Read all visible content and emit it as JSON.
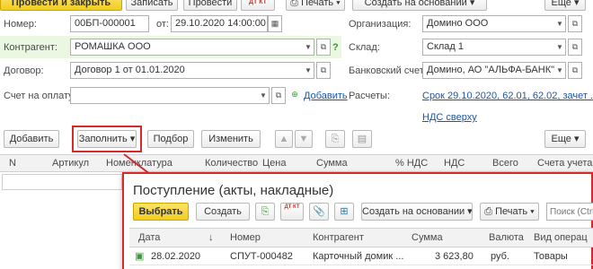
{
  "toolbar": {
    "post_close": "Провести и закрыть",
    "save": "Записать",
    "post": "Провести",
    "dt_kt": "ДТ КТ",
    "print": "Печать",
    "create_based": "Создать на основании",
    "more": "Еще"
  },
  "form": {
    "number_label": "Номер:",
    "number_value": "00БП-000001",
    "date_from_label": "от:",
    "date_value": "29.10.2020 14:00:00",
    "org_label": "Организация:",
    "org_value": "Домино ООО",
    "counterparty_label": "Контрагент:",
    "counterparty_value": "РОМАШКА ООО",
    "help": "?",
    "warehouse_label": "Склад:",
    "warehouse_value": "Склад 1",
    "contract_label": "Договор:",
    "contract_value": "Договор 1 от 01.01.2020",
    "bank_label": "Банковский счет:",
    "bank_value": "Домино, АО \"АЛЬФА-БАНК\"",
    "invoice_label": "Счет на оплату:",
    "invoice_value": "",
    "add_link": "Добавить",
    "settlements_label": "Расчеты:",
    "settlements_link": "Срок 29.10.2020, 62.01, 62.02, зачет ...",
    "vat_link": "НДС сверху"
  },
  "table_toolbar": {
    "add": "Добавить",
    "fill": "Заполнить",
    "select": "Подбор",
    "change": "Изменить",
    "more": "Еще"
  },
  "table": {
    "headers": [
      "N",
      "Артикул",
      "Номенклатура",
      "Количество",
      "Цена",
      "Сумма",
      "% НДС",
      "НДС",
      "Всего",
      "Счета учета"
    ]
  },
  "popup": {
    "title": "Поступление (акты, накладные)",
    "choose": "Выбрать",
    "create": "Создать",
    "dt_kt": "ДТ КТ",
    "create_based": "Создать на основании",
    "print": "Печать",
    "search_placeholder": "Поиск (Ctrl+F)",
    "headers": [
      "Дата",
      "↓",
      "Номер",
      "Контрагент",
      "Сумма",
      "Валюта",
      "Вид операц"
    ],
    "rows": [
      {
        "date": "28.02.2020",
        "number": "СПУТ-000482",
        "counterparty": "Карточный домик ...",
        "amount": "3 623,80",
        "currency": "руб.",
        "operation": "Товары"
      }
    ]
  },
  "colors": {
    "accent_yellow": "#f2cd1e",
    "highlight_red": "#d42a2a",
    "link_blue": "#1a56a6",
    "field_green": "#eaf7e1"
  }
}
